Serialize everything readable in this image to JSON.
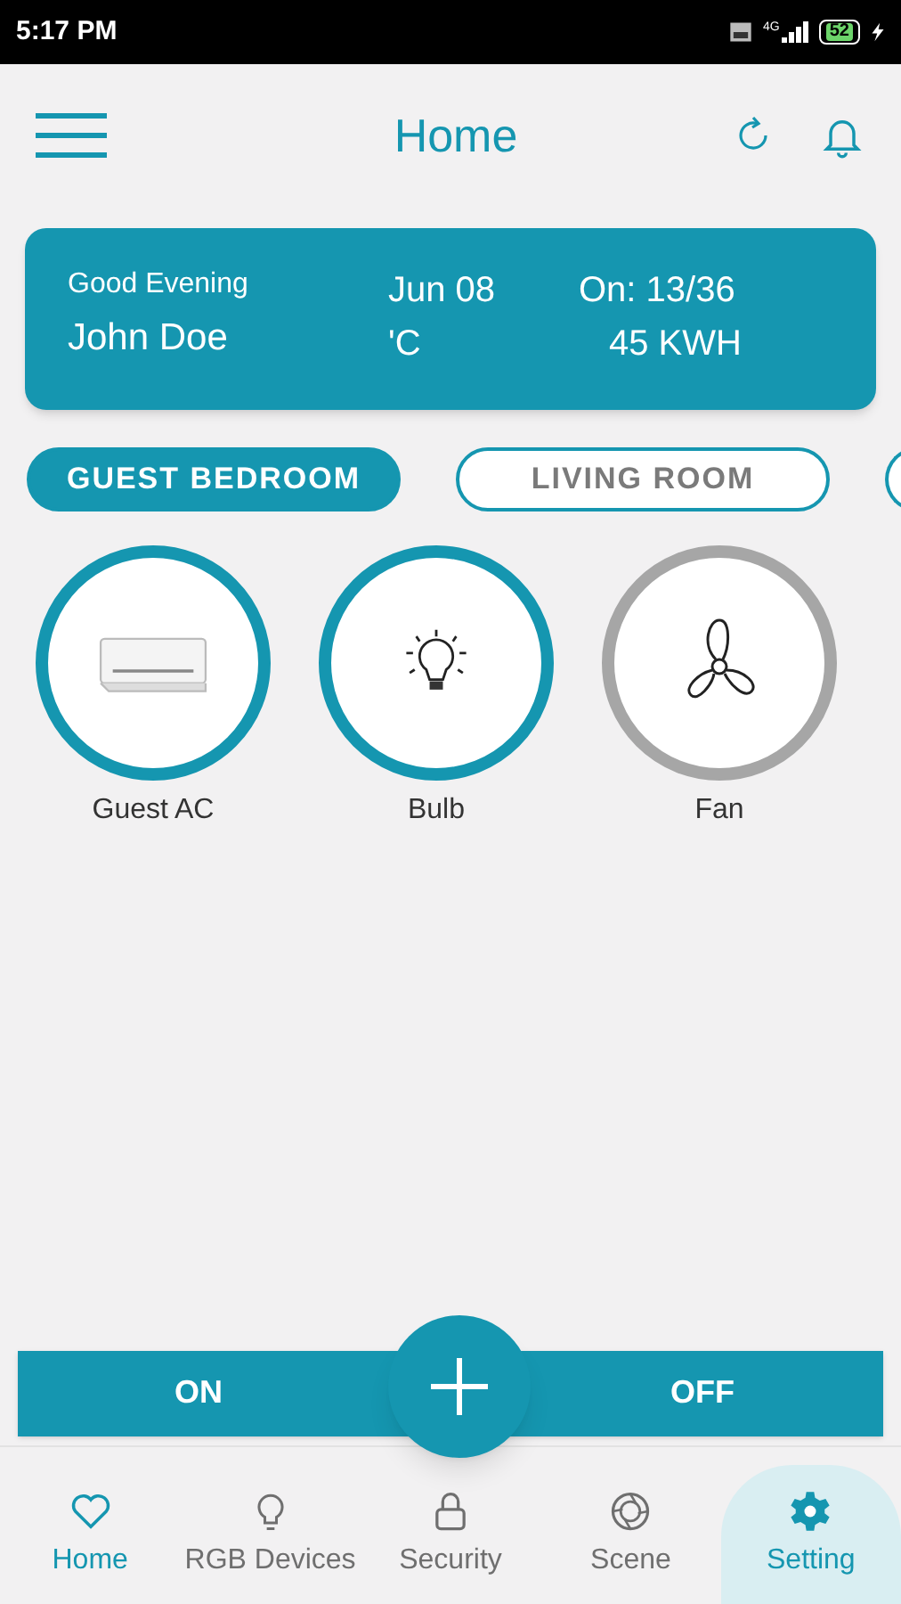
{
  "status_bar": {
    "time": "5:17 PM",
    "network": "4G",
    "battery": "52"
  },
  "header": {
    "title": "Home"
  },
  "summary_card": {
    "greeting": "Good Evening",
    "name": "John Doe",
    "date": "Jun 08",
    "temperature": "'C",
    "devices_on": "On: 13/36",
    "energy": "45 KWH"
  },
  "rooms": [
    {
      "label": "GUEST BEDROOM",
      "selected": true
    },
    {
      "label": "LIVING ROOM",
      "selected": false
    }
  ],
  "rooms_overflow": true,
  "devices": [
    {
      "name": "Guest AC",
      "kind": "ac",
      "on": true
    },
    {
      "name": "Bulb",
      "kind": "bulb",
      "on": true
    },
    {
      "name": "Fan",
      "kind": "fan",
      "on": false
    }
  ],
  "controls": {
    "on_label": "ON",
    "off_label": "OFF"
  },
  "nav": [
    {
      "label": "Home",
      "kind": "heart",
      "selected": true,
      "highlighted": false
    },
    {
      "label": "RGB Devices",
      "kind": "bulb",
      "selected": false,
      "highlighted": false
    },
    {
      "label": "Security",
      "kind": "lock",
      "selected": false,
      "highlighted": false
    },
    {
      "label": "Scene",
      "kind": "aperture",
      "selected": false,
      "highlighted": false
    },
    {
      "label": "Setting",
      "kind": "gear",
      "selected": true,
      "highlighted": true
    }
  ]
}
